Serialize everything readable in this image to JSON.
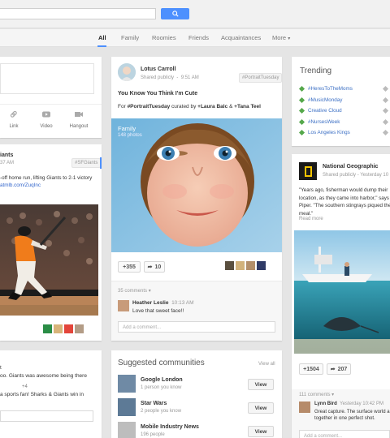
{
  "nav": {
    "tabs": [
      "All",
      "Family",
      "Roomies",
      "Friends",
      "Acquaintances",
      "More"
    ]
  },
  "share": {
    "actions": [
      {
        "label": "Link",
        "icon": "link-icon"
      },
      {
        "label": "Video",
        "icon": "video-icon"
      },
      {
        "label": "Hangout",
        "icon": "hangout-icon"
      }
    ]
  },
  "giants": {
    "author_partial": "iants",
    "time_partial": "37 AM",
    "tag": "#SFGiants",
    "text1": "-off home run, lifting Giants to 2-1 victory",
    "text2": "atmlb.com/ZuqInc"
  },
  "giants_comments": {
    "c1_line1": "t",
    "c1_line2": "oo. Giants was awesome being there",
    "c2_count": "+4",
    "c2_line1": "a sports fan! Sharks & Giants win in"
  },
  "lotus": {
    "name": "Lotus Carroll",
    "meta_shared": "Shared publicly",
    "meta_time": "9:51 AM",
    "tag": "#PortraitTuesday",
    "title": "You Know You Think I'm Cute",
    "credit_pre": "For ",
    "credit_tag": "#PortraitTuesday",
    "credit_mid": " curated by ",
    "credit_p1": "+Laura Balc",
    "credit_and": " & ",
    "credit_p2": "+Tana Teel",
    "album_title": "Family",
    "album_count": "148 photos",
    "plus_count": "+355",
    "share_count": "10",
    "comments_count": "35 comments",
    "commenter": "Heather Leslie",
    "comment_time": "10:13 AM",
    "comment_text": "Love that sweet face!!",
    "add_comment": "Add a comment..."
  },
  "communities": {
    "title": "Suggested communities",
    "view_all": "View all",
    "items": [
      {
        "name": "Google London",
        "sub": "1 person you know",
        "btn": "View"
      },
      {
        "name": "Star Wars",
        "sub": "2 people you know",
        "btn": "View"
      },
      {
        "name": "Mobile Industry News",
        "sub": "196 people",
        "btn": "View"
      }
    ]
  },
  "trending": {
    "title": "Trending",
    "items": [
      "#HeresToTheMoms",
      "#MusicMonday",
      "Creative Cloud",
      "#NursesWeek",
      "Los Angeles Kings"
    ]
  },
  "natgeo": {
    "name": "National Geographic",
    "meta_shared": "Shared publicly",
    "meta_time": "Yesterday 10",
    "text1": "\"Years ago, fisherman would dump their",
    "text2": "location, as they came into harbor,\" says",
    "text3": "Piper. \"The southern stingrays piqued the",
    "text4": "meal.\"",
    "read_more": "Read more",
    "plus_count": "+1504",
    "share_count": "207",
    "comments_count": "111 comments",
    "commenter": "Lynn Bird",
    "comment_time": "Yesterday 10:42 PM",
    "comment_text1": "Great capture. The surface world a",
    "comment_text2": "together in one perfect shot.",
    "add_comment": "Add a comment..."
  },
  "colors": {
    "accent": "#4d90fe",
    "trend_green": "#55a84b",
    "link_blue": "#3b6fc4"
  }
}
